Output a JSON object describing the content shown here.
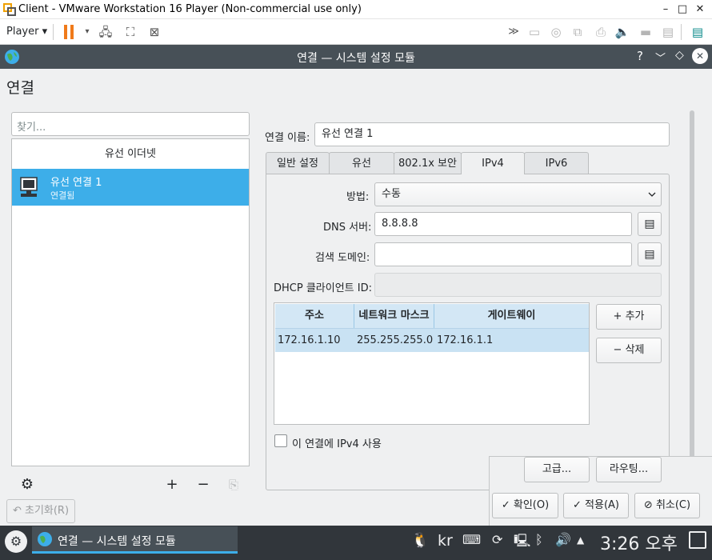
{
  "vmware": {
    "title": "Client - VMware Workstation 16 Player (Non-commercial use only)",
    "player_menu": "Player",
    "toolbar_icons": [
      "pause-icon",
      "send-ctrl-alt-del-icon",
      "fullscreen-icon",
      "unity-icon",
      "forward-icon",
      "hdd-icon",
      "cd-icon",
      "network-icon",
      "printer-icon",
      "sound-icon",
      "usb-icon",
      "floppy-icon",
      "notes-icon"
    ]
  },
  "kde_window": {
    "title": "연결 — 시스템 설정 모듈",
    "help": "?"
  },
  "page_title": "연결",
  "left": {
    "search_placeholder": "찾기...",
    "section_header": "유선 이더넷",
    "connections": [
      {
        "name": "유선 연결 1",
        "status": "연결됨"
      }
    ],
    "reset_label": "초기화(R)"
  },
  "form": {
    "name_label": "연결 이름:",
    "name_value": "유선 연결 1",
    "tabs": [
      "일반 설정",
      "유선",
      "802.1x 보안",
      "IPv4",
      "IPv6"
    ],
    "active_tab": "IPv4",
    "method_label": "방법:",
    "method_value": "수동",
    "dns_label": "DNS 서버:",
    "dns_value": "8.8.8.8",
    "search_domain_label": "검색 도메인:",
    "search_domain_value": "",
    "dhcp_label": "DHCP 클라이언트 ID:",
    "dhcp_value": "",
    "table_headers": [
      "주소",
      "네트워크 마스크",
      "게이트웨이"
    ],
    "table_rows": [
      [
        "172.16.1.10",
        "255.255.255.0",
        "172.16.1.1"
      ]
    ],
    "add_label": "추가",
    "delete_label": "삭제",
    "require_ipv4_label": "이 연결에 IPv4 사용",
    "require_ipv4_checked": false,
    "advanced_label": "고급...",
    "routing_label": "라우팅..."
  },
  "footer": {
    "ok_label": "확인(O)",
    "apply_label": "적용(A)",
    "cancel_label": "취소(C)"
  },
  "taskbar": {
    "task_title": "연결 — 시스템 설정 모듈",
    "keyboard_layout": "kr",
    "clock": "3:26 오후"
  },
  "colors": {
    "selection": "#3daee9",
    "titlebar": "#475057",
    "taskbar": "#31363b"
  }
}
